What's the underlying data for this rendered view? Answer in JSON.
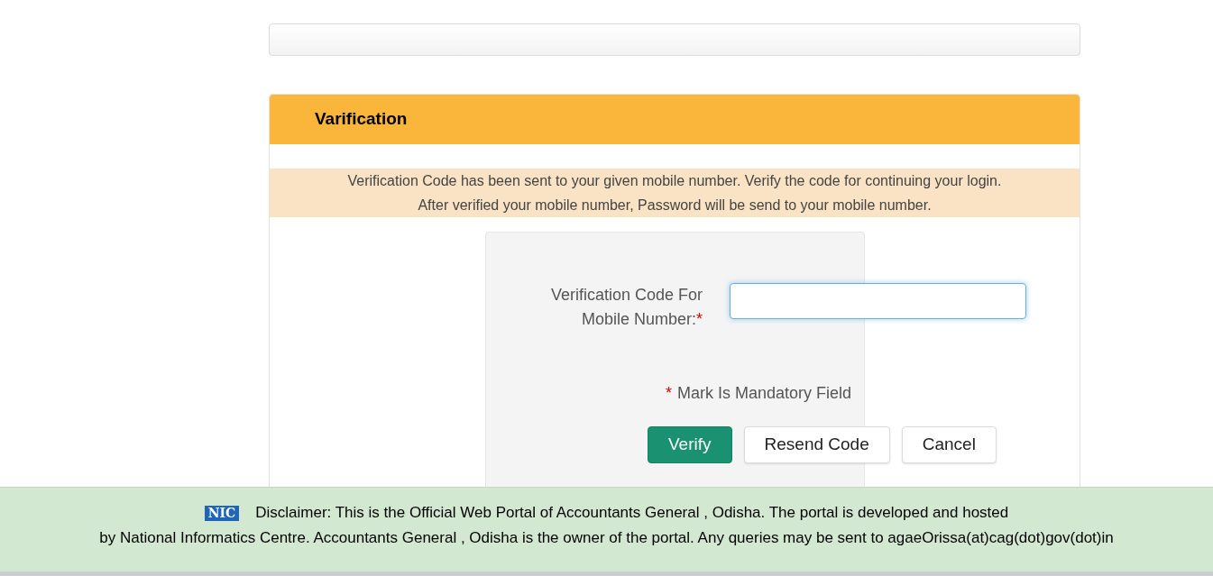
{
  "panel": {
    "title": "Varification"
  },
  "notice": [
    "Verification Code has been sent to your given mobile number. Verify the code for continuing your login.",
    "After verified your mobile number, Password will be send to your mobile number."
  ],
  "form": {
    "label": "Verification Code For Mobile Number:",
    "required_mark": "*",
    "note_mark": "*",
    "note": "Mark Is Mandatory Field"
  },
  "buttons": [
    {
      "kind": "primary",
      "label": "Verify"
    },
    {
      "kind": "default",
      "label": "Resend Code"
    },
    {
      "kind": "default",
      "label": "Cancel"
    }
  ],
  "footer": {
    "logo": "NIC",
    "lines": [
      "Disclaimer: This is the Official Web Portal of Accountants General , Odisha. The portal is developed and hosted",
      "by National Informatics Centre. Accountants General , Odisha is the owner of the portal. Any queries may be sent to agaeOrissa(at)cag(dot)gov(dot)in"
    ]
  }
}
